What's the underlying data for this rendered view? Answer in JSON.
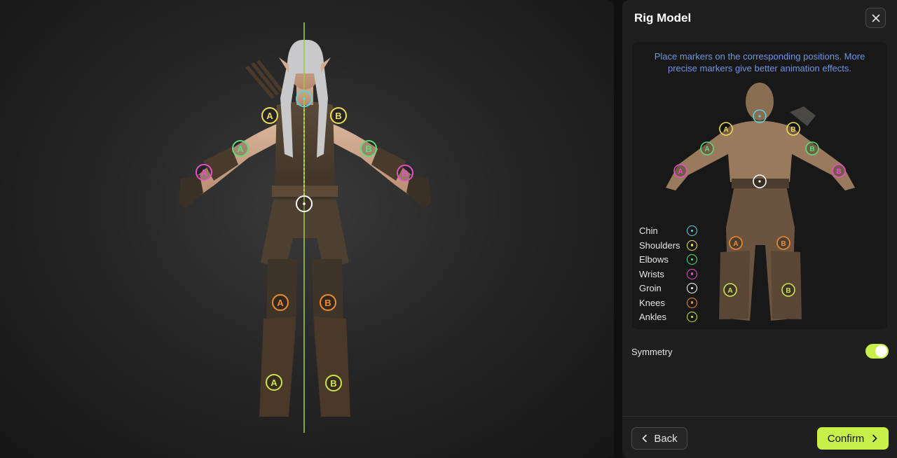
{
  "panel": {
    "title": "Rig Model",
    "instructions": "Place markers on the corresponding positions. More precise markers give better animation effects.",
    "legend": [
      {
        "label": "Chin",
        "color": "#5fd0dc"
      },
      {
        "label": "Shoulders",
        "color": "#f0dc5a"
      },
      {
        "label": "Elbows",
        "color": "#5fdc78"
      },
      {
        "label": "Wrists",
        "color": "#e650c8"
      },
      {
        "label": "Groin",
        "color": "#ffffff"
      },
      {
        "label": "Knees",
        "color": "#f08c32"
      },
      {
        "label": "Ankles",
        "color": "#c8e650"
      }
    ],
    "symmetry_label": "Symmetry",
    "symmetry_on": true,
    "back_label": "Back",
    "confirm_label": "Confirm"
  },
  "markers": {
    "side_a": "A",
    "side_b": "B"
  },
  "colors": {
    "accent": "#c8f04a",
    "center_line": "#9acd32"
  }
}
